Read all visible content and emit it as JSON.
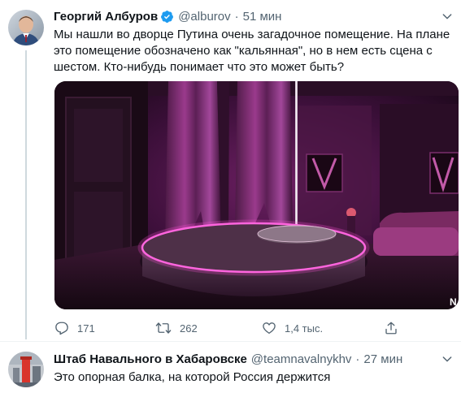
{
  "tweet": {
    "author_name": "Георгий Албуров",
    "handle": "@alburov",
    "separator": "·",
    "time": "51 мин",
    "text": "Мы нашли во дворце Путина очень загадочное помещение. На плане это помещение обозначено как \"кальянная\", но в нем есть сцена с шестом. Кто-нибудь понимает что это может быть?",
    "media_watermark": "N",
    "actions": {
      "reply_count": "171",
      "retweet_count": "262",
      "like_count": "1,4 тыс."
    }
  },
  "reply": {
    "author_name": "Штаб Навального в Хабаровске",
    "handle": "@teamnavalnykhv",
    "separator": "·",
    "time": "27 мин",
    "text": "Это опорная балка, на которой Россия держится"
  },
  "colors": {
    "verified": "#1d9bf0",
    "muted_text": "#536471",
    "divider": "#eff3f4"
  },
  "icons": [
    "verified-badge-icon",
    "chevron-down-icon",
    "reply-icon",
    "retweet-icon",
    "like-icon",
    "share-icon"
  ]
}
